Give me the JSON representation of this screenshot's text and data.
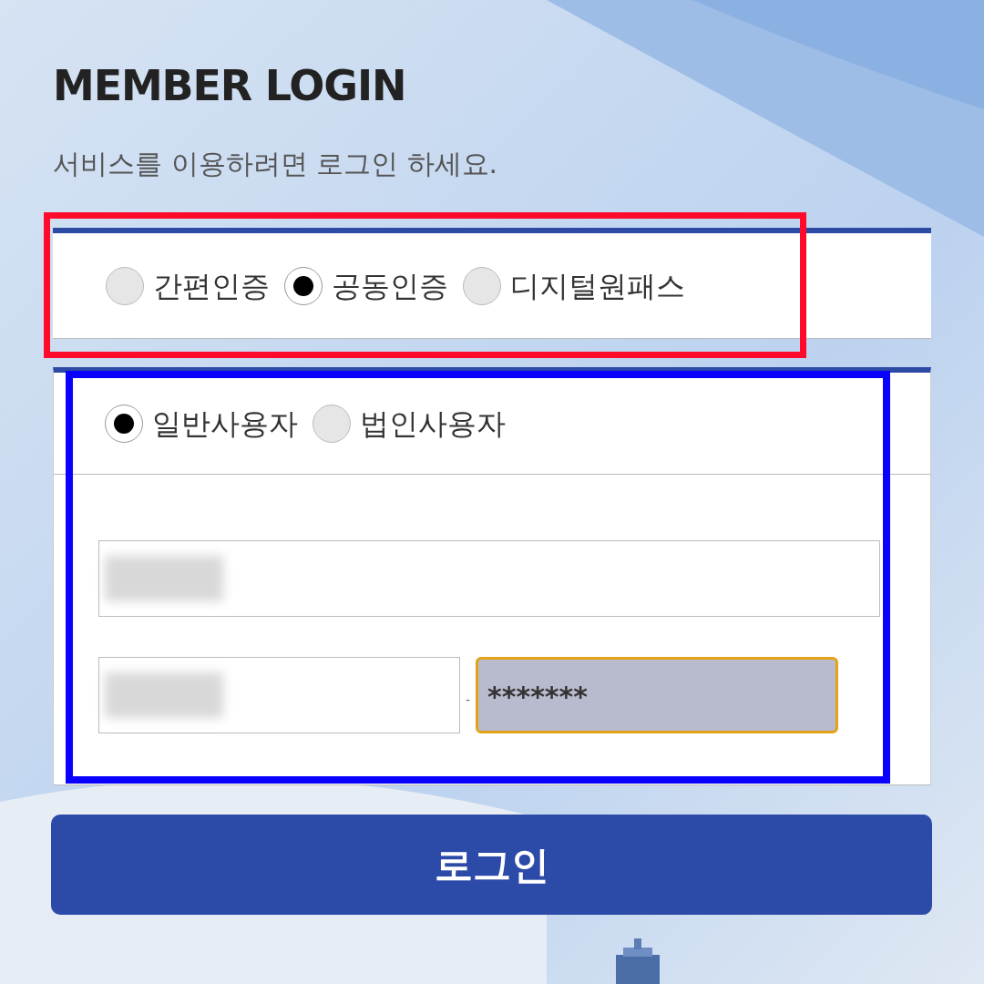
{
  "title": "MEMBER LOGIN",
  "subtitle": "서비스를 이용하려면 로그인 하세요.",
  "auth_methods": [
    {
      "label": "간편인증",
      "selected": false
    },
    {
      "label": "공동인증",
      "selected": true
    },
    {
      "label": "디지털원패스",
      "selected": false
    }
  ],
  "user_types": [
    {
      "label": "일반사용자",
      "selected": true
    },
    {
      "label": "법인사용자",
      "selected": false
    }
  ],
  "fields": [
    {
      "kind": "redacted"
    },
    {
      "kind": "redacted"
    },
    {
      "kind": "password",
      "value": "*******",
      "focused": true
    }
  ],
  "separator": "-",
  "login_button": "로그인",
  "annotations": [
    {
      "color": "#ff0a2a"
    },
    {
      "color": "#0a00ff"
    }
  ]
}
